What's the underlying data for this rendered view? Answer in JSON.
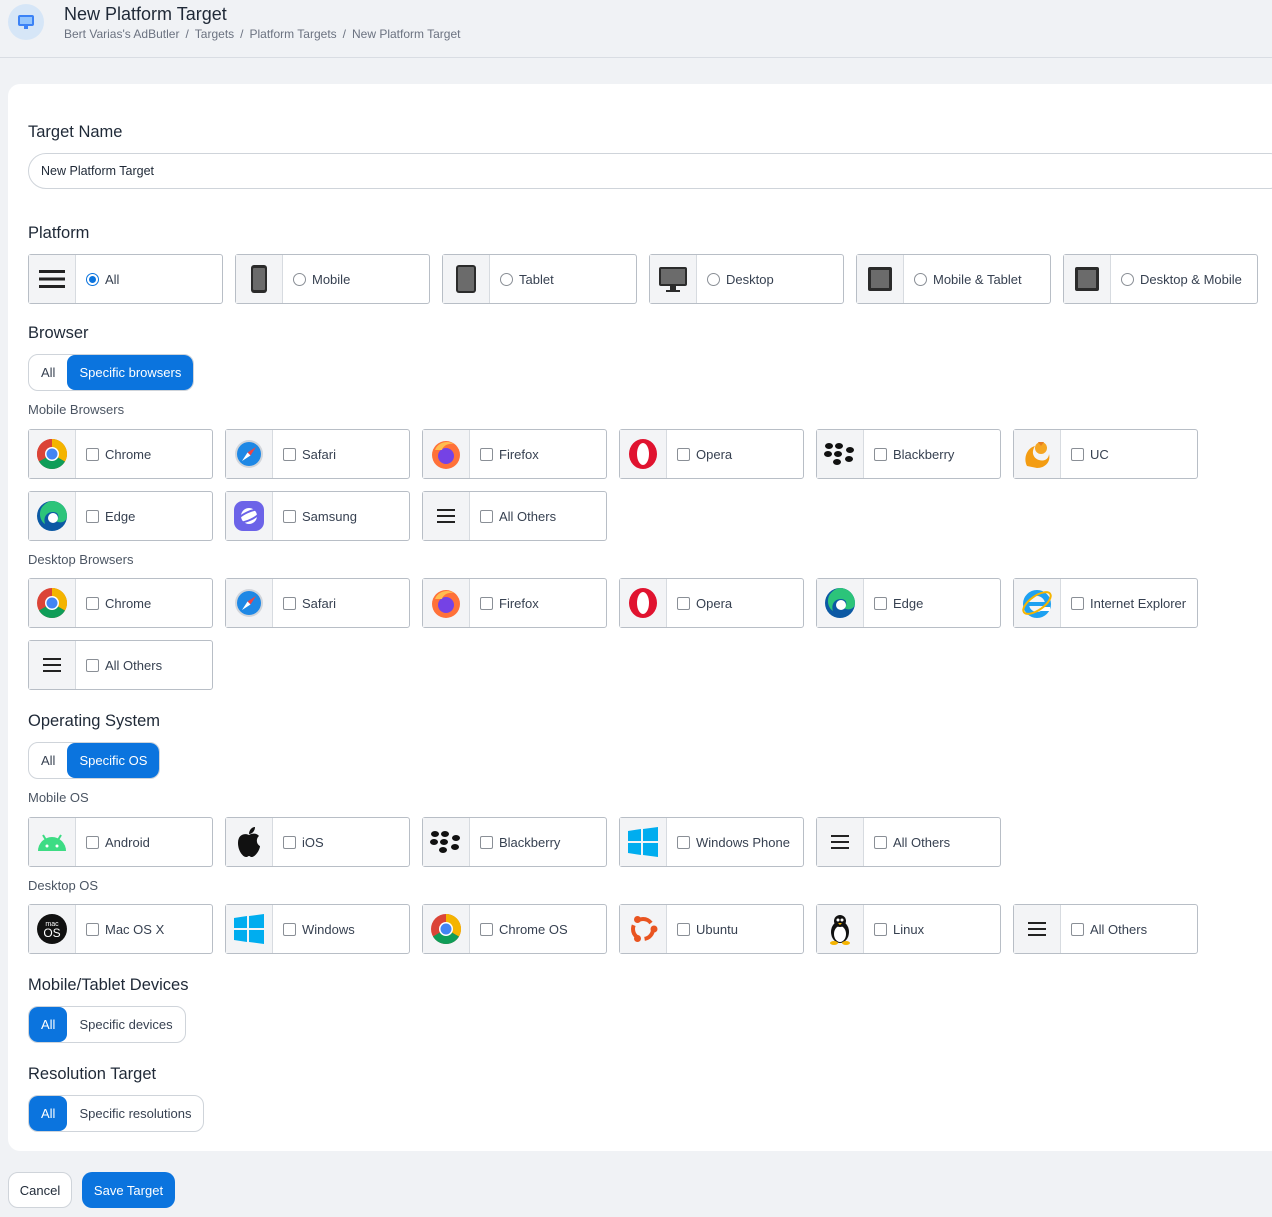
{
  "header": {
    "title": "New Platform Target",
    "breadcrumbs": [
      "Bert Varias's AdButler",
      "Targets",
      "Platform Targets",
      "New Platform Target"
    ],
    "separator": "/"
  },
  "target_name": {
    "label": "Target Name",
    "value": "New Platform Target"
  },
  "platform": {
    "label": "Platform",
    "options": [
      {
        "label": "All",
        "icon": "menu-icon",
        "selected": true
      },
      {
        "label": "Mobile",
        "icon": "mobile-icon",
        "selected": false
      },
      {
        "label": "Tablet",
        "icon": "tablet-icon",
        "selected": false
      },
      {
        "label": "Desktop",
        "icon": "desktop-icon",
        "selected": false
      },
      {
        "label": "Mobile & Tablet",
        "icon": "square-icon",
        "selected": false
      },
      {
        "label": "Desktop & Mobile",
        "icon": "square-icon",
        "selected": false
      }
    ]
  },
  "browser": {
    "label": "Browser",
    "toggle": {
      "all": "All",
      "specific": "Specific browsers",
      "selected": "specific"
    },
    "mobile_label": "Mobile Browsers",
    "mobile": [
      "Chrome",
      "Safari",
      "Firefox",
      "Opera",
      "Blackberry",
      "UC",
      "Edge",
      "Samsung",
      "All Others"
    ],
    "desktop_label": "Desktop Browsers",
    "desktop": [
      "Chrome",
      "Safari",
      "Firefox",
      "Opera",
      "Edge",
      "Internet Explorer",
      "All Others"
    ]
  },
  "os": {
    "label": "Operating System",
    "toggle": {
      "all": "All",
      "specific": "Specific OS",
      "selected": "specific"
    },
    "mobile_label": "Mobile OS",
    "mobile": [
      "Android",
      "iOS",
      "Blackberry",
      "Windows Phone",
      "All Others"
    ],
    "desktop_label": "Desktop OS",
    "desktop": [
      "Mac OS X",
      "Windows",
      "Chrome OS",
      "Ubuntu",
      "Linux",
      "All Others"
    ]
  },
  "devices": {
    "label": "Mobile/Tablet Devices",
    "toggle": {
      "all": "All",
      "specific": "Specific devices",
      "selected": "all"
    }
  },
  "resolution": {
    "label": "Resolution Target",
    "toggle": {
      "all": "All",
      "specific": "Specific resolutions",
      "selected": "all"
    }
  },
  "actions": {
    "cancel": "Cancel",
    "save": "Save Target"
  },
  "colors": {
    "accent": "#0b74de",
    "panel": "#ffffff",
    "background": "#f0f2f5"
  },
  "icons": {
    "mac_os_top": "mac",
    "mac_os_bottom": "OS"
  }
}
